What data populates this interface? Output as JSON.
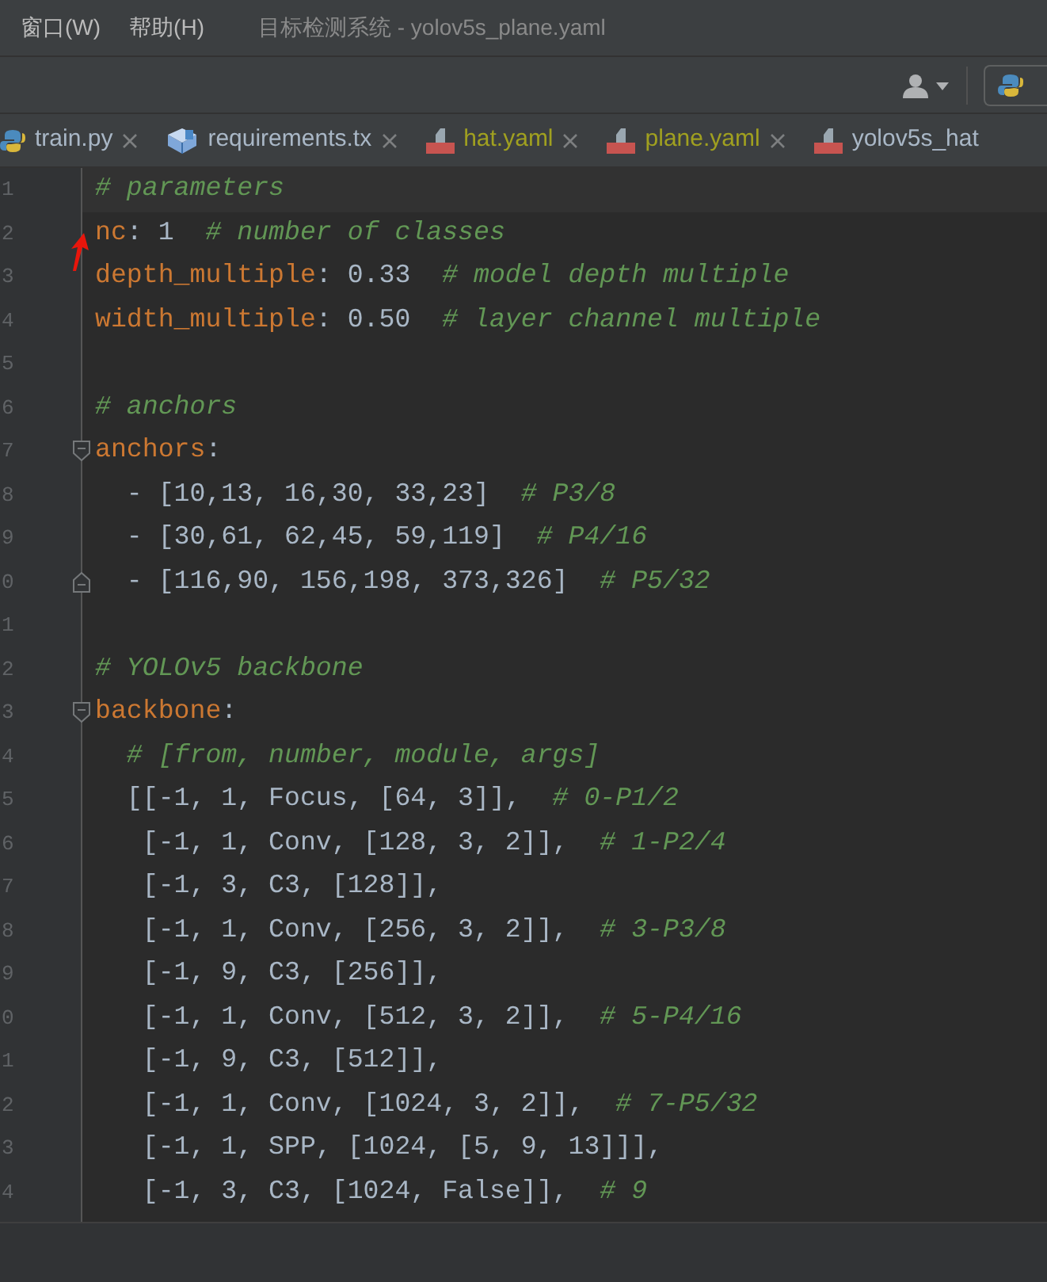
{
  "menu": [
    {
      "label": "窗口(W)"
    },
    {
      "label": "帮助(H)"
    }
  ],
  "window": {
    "title": "目标检测系统 - yolov5s_plane.yaml"
  },
  "tabs": [
    {
      "label": "train.py",
      "kind": "python",
      "color": "#a9b7c6",
      "closable": true
    },
    {
      "label": "requirements.tx",
      "kind": "text",
      "color": "#a9b7c6",
      "closable": true
    },
    {
      "label": "hat.yaml",
      "kind": "yaml",
      "color": "#a0a020",
      "closable": true
    },
    {
      "label": "plane.yaml",
      "kind": "yaml",
      "color": "#a0a020",
      "closable": true
    },
    {
      "label": "yolov5s_hat",
      "kind": "yaml",
      "color": "#a9b7c6",
      "closable": false
    }
  ],
  "lines": [
    {
      "number": "1",
      "current": true,
      "tokens": [
        {
          "kind": "comment",
          "text": "# parameters"
        }
      ]
    },
    {
      "number": "2",
      "tokens": [
        {
          "kind": "key",
          "text": "nc"
        },
        {
          "kind": "text",
          "text": ": 1  "
        },
        {
          "kind": "comment",
          "text": "# number of classes"
        }
      ]
    },
    {
      "number": "3",
      "tokens": [
        {
          "kind": "key",
          "text": "depth_multiple"
        },
        {
          "kind": "text",
          "text": ": 0.33  "
        },
        {
          "kind": "comment",
          "text": "# model depth multiple"
        }
      ]
    },
    {
      "number": "4",
      "tokens": [
        {
          "kind": "key",
          "text": "width_multiple"
        },
        {
          "kind": "text",
          "text": ": 0.50  "
        },
        {
          "kind": "comment",
          "text": "# layer channel multiple"
        }
      ]
    },
    {
      "number": "5"
    },
    {
      "number": "6",
      "tokens": [
        {
          "kind": "comment",
          "text": "# anchors"
        }
      ]
    },
    {
      "number": "7",
      "kind": "fold_start",
      "tokens": [
        {
          "kind": "key",
          "text": "anchors"
        },
        {
          "kind": "text",
          "text": ":"
        }
      ]
    },
    {
      "number": "8",
      "tokens": [
        {
          "kind": "text",
          "text": "  - [10,13, 16,30, 33,23]  "
        },
        {
          "kind": "comment",
          "text": "# P3/8"
        }
      ]
    },
    {
      "number": "9",
      "tokens": [
        {
          "kind": "text",
          "text": "  - [30,61, 62,45, 59,119]  "
        },
        {
          "kind": "comment",
          "text": "# P4/16"
        }
      ]
    },
    {
      "number": "0",
      "kind": "fold_end",
      "tokens": [
        {
          "kind": "text",
          "text": "  - [116,90, 156,198, 373,326]  "
        },
        {
          "kind": "comment",
          "text": "# P5/32"
        }
      ]
    },
    {
      "number": "1"
    },
    {
      "number": "2",
      "tokens": [
        {
          "kind": "comment",
          "text": "# YOLOv5 backbone"
        }
      ]
    },
    {
      "number": "3",
      "kind": "fold_start",
      "tokens": [
        {
          "kind": "key",
          "text": "backbone"
        },
        {
          "kind": "text",
          "text": ":"
        }
      ]
    },
    {
      "number": "4",
      "tokens": [
        {
          "kind": "comment",
          "text": "  # [from, number, module, args]"
        }
      ]
    },
    {
      "number": "5",
      "tokens": [
        {
          "kind": "text",
          "text": "  [[-1, 1, Focus, [64, 3]],  "
        },
        {
          "kind": "comment",
          "text": "# 0-P1/2"
        }
      ]
    },
    {
      "number": "6",
      "tokens": [
        {
          "kind": "text",
          "text": "   [-1, 1, Conv, [128, 3, 2]],  "
        },
        {
          "kind": "comment",
          "text": "# 1-P2/4"
        }
      ]
    },
    {
      "number": "7",
      "tokens": [
        {
          "kind": "text",
          "text": "   [-1, 3, C3, [128]],"
        }
      ]
    },
    {
      "number": "8",
      "tokens": [
        {
          "kind": "text",
          "text": "   [-1, 1, Conv, [256, 3, 2]],  "
        },
        {
          "kind": "comment",
          "text": "# 3-P3/8"
        }
      ]
    },
    {
      "number": "9",
      "tokens": [
        {
          "kind": "text",
          "text": "   [-1, 9, C3, [256]],"
        }
      ]
    },
    {
      "number": "0",
      "tokens": [
        {
          "kind": "text",
          "text": "   [-1, 1, Conv, [512, 3, 2]],  "
        },
        {
          "kind": "comment",
          "text": "# 5-P4/16"
        }
      ]
    },
    {
      "number": "1",
      "tokens": [
        {
          "kind": "text",
          "text": "   [-1, 9, C3, [512]],"
        }
      ]
    },
    {
      "number": "2",
      "tokens": [
        {
          "kind": "text",
          "text": "   [-1, 1, Conv, [1024, 3, 2]],  "
        },
        {
          "kind": "comment",
          "text": "# 7-P5/32"
        }
      ]
    },
    {
      "number": "3",
      "tokens": [
        {
          "kind": "text",
          "text": "   [-1, 1, SPP, [1024, [5, 9, 13]]],"
        }
      ]
    },
    {
      "number": "4",
      "tokens": [
        {
          "kind": "text",
          "text": "   [-1, 3, C3, [1024, False]],  "
        },
        {
          "kind": "comment",
          "text": "# 9"
        }
      ]
    }
  ]
}
